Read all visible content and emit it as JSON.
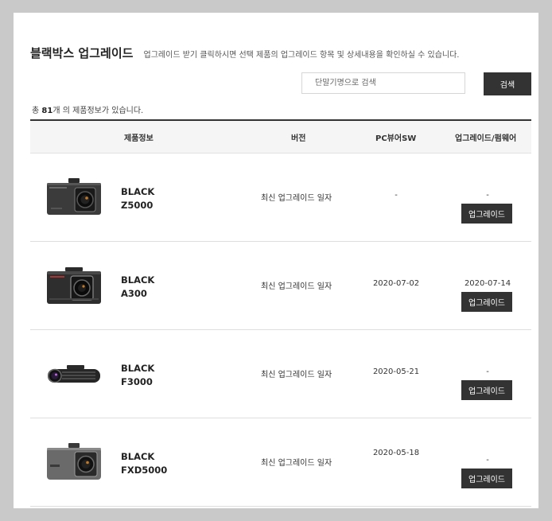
{
  "header": {
    "title": "블랙박스 업그레이드",
    "subtitle": "업그레이드 받기 클릭하시면 선택 제품의 업그레이드 항목 및 상세내용을 확인하실 수 있습니다."
  },
  "search": {
    "placeholder": "단말기명으로 검색",
    "button_label": "검색"
  },
  "summary": {
    "prefix": "총",
    "count": "81",
    "suffix": "개 의 제품정보가 있습니다."
  },
  "table": {
    "columns": [
      "제품정보",
      "버전",
      "PC뷰어SW",
      "업그레이드/펌웨어"
    ],
    "rows": [
      {
        "brand": "BLACK",
        "model": "Z5000",
        "version": "최신 업그레이드 일자",
        "pc_viewer": "-",
        "firmware": "-",
        "button": "업그레이드",
        "camera_icon": "dashcam-z5000"
      },
      {
        "brand": "BLACK",
        "model": "A300",
        "version": "최신 업그레이드 일자",
        "pc_viewer": "2020-07-02",
        "firmware": "2020-07-14",
        "button": "업그레이드",
        "camera_icon": "dashcam-a300"
      },
      {
        "brand": "BLACK",
        "model": "F3000",
        "version": "최신 업그레이드 일자",
        "pc_viewer": "2020-05-21",
        "firmware": "-",
        "button": "업그레이드",
        "camera_icon": "dashcam-f3000"
      },
      {
        "brand": "BLACK",
        "model": "FXD5000",
        "version": "최신 업그레이드 일자",
        "pc_viewer": "2020-05-18",
        "firmware": "-",
        "button": "업그레이드",
        "camera_icon": "dashcam-fxd5000"
      }
    ]
  },
  "colors": {
    "background": "#c9c9c9",
    "panel": "#ffffff",
    "button": "#333333",
    "header_row": "#f5f5f5"
  }
}
